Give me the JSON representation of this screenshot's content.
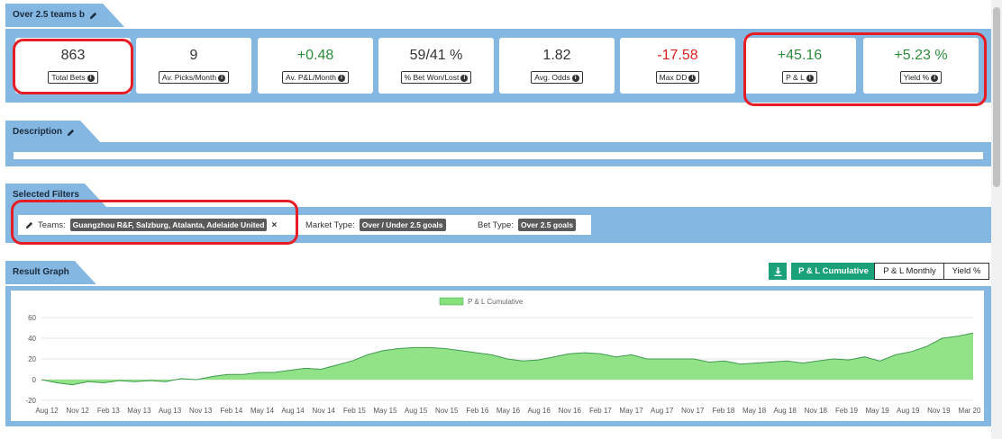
{
  "header": {
    "title": "Over 2.5 teams b"
  },
  "stats": [
    {
      "value": "863",
      "label": "Total Bets",
      "tone": "neutral"
    },
    {
      "value": "9",
      "label": "Av. Picks/Month",
      "tone": "neutral"
    },
    {
      "value": "+0.48",
      "label": "Av. P&L/Month",
      "tone": "pos"
    },
    {
      "value": "59/41 %",
      "label": "% Bet Won/Lost",
      "tone": "neutral"
    },
    {
      "value": "1.82",
      "label": "Avg. Odds",
      "tone": "neutral"
    },
    {
      "value": "-17.58",
      "label": "Max DD",
      "tone": "neg"
    },
    {
      "value": "+45.16",
      "label": "P & L",
      "tone": "pos"
    },
    {
      "value": "+5.23 %",
      "label": "Yield %",
      "tone": "pos"
    }
  ],
  "description": {
    "title": "Description"
  },
  "filters": {
    "title": "Selected Filters",
    "teams_label": "Teams:",
    "teams_value": "Guangzhou R&F, Salzburg, Atalanta, Adelaide United",
    "market_label": "Market Type:",
    "market_value": "Over / Under 2.5 goals",
    "bet_label": "Bet Type:",
    "bet_value": "Over 2.5 goals"
  },
  "graph": {
    "title": "Result Graph",
    "buttons": {
      "cumulative": "P & L Cumulative",
      "monthly": "P & L Monthly",
      "yield": "Yield %"
    },
    "active_button": "cumulative"
  },
  "colors": {
    "band": "#85b7e3",
    "accent": "#1aa179",
    "fill": "#86e07a",
    "stroke": "#3f9a4f",
    "highlight": "#e51d24"
  },
  "chart_data": {
    "type": "area",
    "legend": "P & L Cumulative",
    "legend_position": "top-center",
    "grid": true,
    "ylim": [
      -20,
      60
    ],
    "yticks": [
      -20,
      0,
      20,
      40,
      60
    ],
    "x_ticks": [
      "Aug 12",
      "Nov 12",
      "Feb 13",
      "May 13",
      "Aug 13",
      "Nov 13",
      "Feb 14",
      "May 14",
      "Aug 14",
      "Nov 14",
      "Feb 15",
      "May 15",
      "Aug 15",
      "Nov 15",
      "Feb 16",
      "May 16",
      "Aug 16",
      "Nov 16",
      "Feb 17",
      "May 17",
      "Aug 17",
      "Nov 17",
      "Feb 18",
      "May 18",
      "Aug 18",
      "Nov 18",
      "Feb 19",
      "May 19",
      "Aug 19",
      "Nov 19",
      "Mar 20"
    ],
    "x": [
      "Aug 12",
      "Oct 12",
      "Nov 12",
      "Jan 13",
      "Feb 13",
      "Mar 13",
      "May 13",
      "Jul 13",
      "Aug 13",
      "Oct 13",
      "Nov 13",
      "Jan 14",
      "Feb 14",
      "Apr 14",
      "May 14",
      "Jul 14",
      "Aug 14",
      "Oct 14",
      "Nov 14",
      "Jan 15",
      "Feb 15",
      "Apr 15",
      "May 15",
      "Jul 15",
      "Aug 15",
      "Oct 15",
      "Nov 15",
      "Jan 16",
      "Feb 16",
      "Apr 16",
      "May 16",
      "Jul 16",
      "Aug 16",
      "Oct 16",
      "Nov 16",
      "Jan 17",
      "Feb 17",
      "Apr 17",
      "May 17",
      "Jul 17",
      "Aug 17",
      "Oct 17",
      "Nov 17",
      "Jan 18",
      "Feb 18",
      "Apr 18",
      "May 18",
      "Jul 18",
      "Aug 18",
      "Oct 18",
      "Nov 18",
      "Jan 19",
      "Feb 19",
      "Apr 19",
      "May 19",
      "Jul 19",
      "Aug 19",
      "Oct 19",
      "Nov 19",
      "Jan 20",
      "Mar 20"
    ],
    "values": [
      0,
      -3,
      -5,
      -2,
      -3,
      -1,
      -2,
      -1,
      -2,
      1,
      0,
      3,
      5,
      5,
      7,
      7,
      9,
      11,
      10,
      14,
      18,
      24,
      28,
      30,
      31,
      31,
      30,
      28,
      26,
      24,
      20,
      18,
      19,
      22,
      25,
      26,
      25,
      22,
      24,
      20,
      20,
      20,
      20,
      17,
      18,
      15,
      16,
      17,
      18,
      16,
      18,
      20,
      19,
      22,
      18,
      24,
      27,
      32,
      40,
      42,
      45
    ]
  }
}
